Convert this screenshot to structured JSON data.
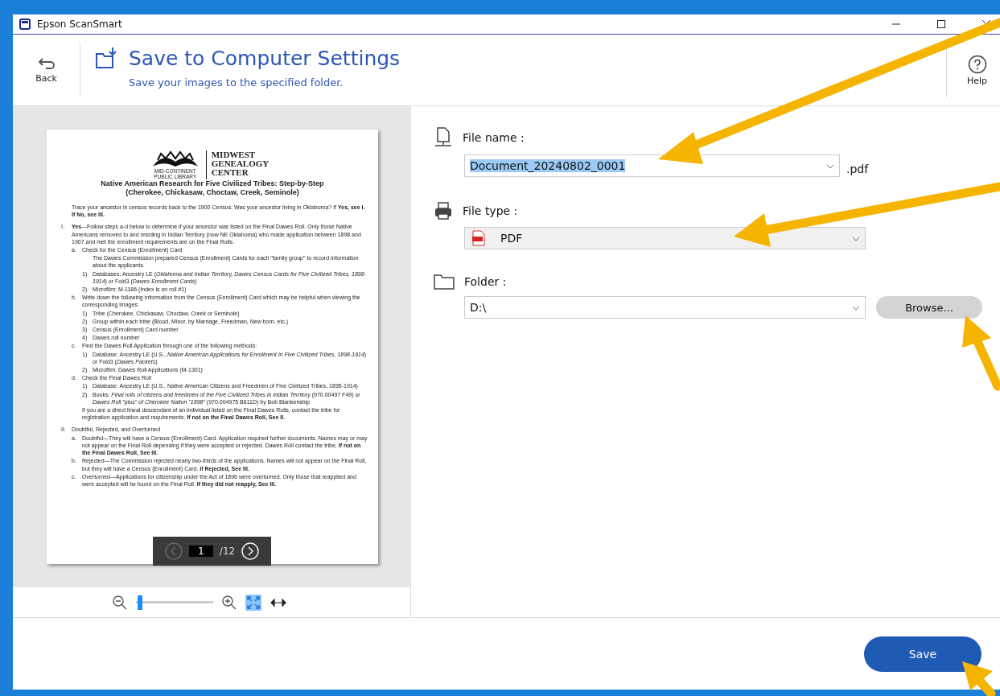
{
  "window": {
    "title": "Epson ScanSmart"
  },
  "header": {
    "back_label": "Back",
    "title": "Save to Computer Settings",
    "subtitle": "Save your images to the specified folder.",
    "help_label": "Help"
  },
  "document": {
    "logo_title": [
      "MIDWEST",
      "GENEALOGY",
      "CENTER"
    ],
    "logo_caption": [
      "MID-CONTINENT",
      "PUBLIC LIBRARY"
    ],
    "heading": [
      "Native American Research for Five Civilized Tribes: Step-by-Step",
      "(Cherokee, Chickasaw, Choctaw, Creek, Seminole)"
    ],
    "blocks": [
      {
        "text": "Trace your ancestor in census records back to the 1900 Census. Was your ancestor living in Oklahoma? If **Yes, see I. If No, see III.**"
      },
      {
        "marker": "I.",
        "text": "**Yes**—Follow steps a-d below to determine if your ancestor was listed on the Final Dawes Roll. Only those Native Americans removed to and residing in Indian Territory (now NE Oklahoma) who made application between 1898 and 1907 and met the enrollment requirements are on the Final Rolls.",
        "children": [
          {
            "marker": "a.",
            "text": "Check for the Census (Enrollment) Card",
            "children": [
              {
                "text": "The Dawes Commission prepared Census (Enrollment) Cards for each \"family group\" to record information about the applicants."
              },
              {
                "marker": "1)",
                "text": "Databases: Ancestry LE (*Oklahoma and Indian Territory, Dawes Census Cards for Five Civilized Tribes, 1898-1914*) or Fold3 (*Dawes Enrollment Cards*)"
              },
              {
                "marker": "2)",
                "text": "Microfilm: M-1186 (Index is on roll #1)"
              }
            ]
          },
          {
            "marker": "b.",
            "text": "Write down the following information from the Census (Enrollment) Card which may be helpful when viewing the corresponding images:",
            "children": [
              {
                "marker": "1)",
                "text": "Tribe (Cherokee, Chickasaw, Choctaw, Creek or Seminole)"
              },
              {
                "marker": "2)",
                "text": "Group within each tribe (Blood, Minor, by Marriage, Freedman, New born, etc.)"
              },
              {
                "marker": "3)",
                "text": "Census (Enrollment) Card number"
              },
              {
                "marker": "4)",
                "text": "Dawes roll number"
              }
            ]
          },
          {
            "marker": "c.",
            "text": "Find the Dawes Roll Application through one of the following methods:",
            "children": [
              {
                "marker": "1)",
                "text": "Database: Ancestry LE (U.S., *Native American Applications for Enrollment in Five Civilized Tribes, 1898-1914*) or Fold3 (*Dawes Packets*)"
              },
              {
                "marker": "2)",
                "text": "Microfilm: Dawes Roll Applications (M-1301)"
              }
            ]
          },
          {
            "marker": "d.",
            "text": "Check the Final Dawes Roll",
            "children": [
              {
                "marker": "1)",
                "text": "Database: Ancestry LE (U.S., Native American Citizens and Freedmen of Five Civilized Tribes, 1895-1914)"
              },
              {
                "marker": "2)",
                "text": "Books: *Final rolls of citizens and freedmen of the Five Civilized Tribes in Indian Territory* (970.00497 F49) or *Dawes Roll \"plus\" of Cherokee Nation \"1898\"* (970.004975 B611D) by Bob Blankenship"
              }
            ]
          },
          {
            "text": "If you are a direct lineal descendant of an individual listed on the Final Dawes Rolls, contact the tribe for registration application and requirements. **If not on the Final Dawes Roll, See II.**"
          }
        ]
      },
      {
        "marker": "II.",
        "text": "Doubtful, Rejected, and Overturned",
        "children": [
          {
            "marker": "a.",
            "text": "Doubtful—They will have a Census (Enrollment) Card. Application required further documents. Names may or may not appear on the Final Roll depending if they were accepted or rejected. Dawes Roll contact the tribe, **If not on the Final Dawes Roll, See III.**"
          },
          {
            "marker": "b.",
            "text": "Rejected—The Commission rejected nearly two-thirds of the applications. Names will not appear on the Final Roll, but they will have a Census (Enrollment) Card. **If Rejected, See III.**"
          },
          {
            "marker": "c.",
            "text": "Overturned—Applications for citizenship under the Act of 1896 were overturned. Only those that reapplied and were accepted will be found on the Final Roll. **If they did not reapply, See III.**"
          }
        ]
      }
    ]
  },
  "pager": {
    "page": "1",
    "total": "/12",
    "prev_disabled": true
  },
  "zoom": {
    "level": 0.02,
    "fit_page_selected": true,
    "fit_width_selected": false
  },
  "form": {
    "file_name": {
      "label": "File name :",
      "value": "Document_20240802_0001",
      "text_selected": true,
      "extension": ".pdf"
    },
    "file_type": {
      "label": "File type :",
      "value": "PDF"
    },
    "folder": {
      "label": "Folder :",
      "value": "D:\\",
      "browse": "Browse..."
    }
  },
  "save_button": "Save"
}
